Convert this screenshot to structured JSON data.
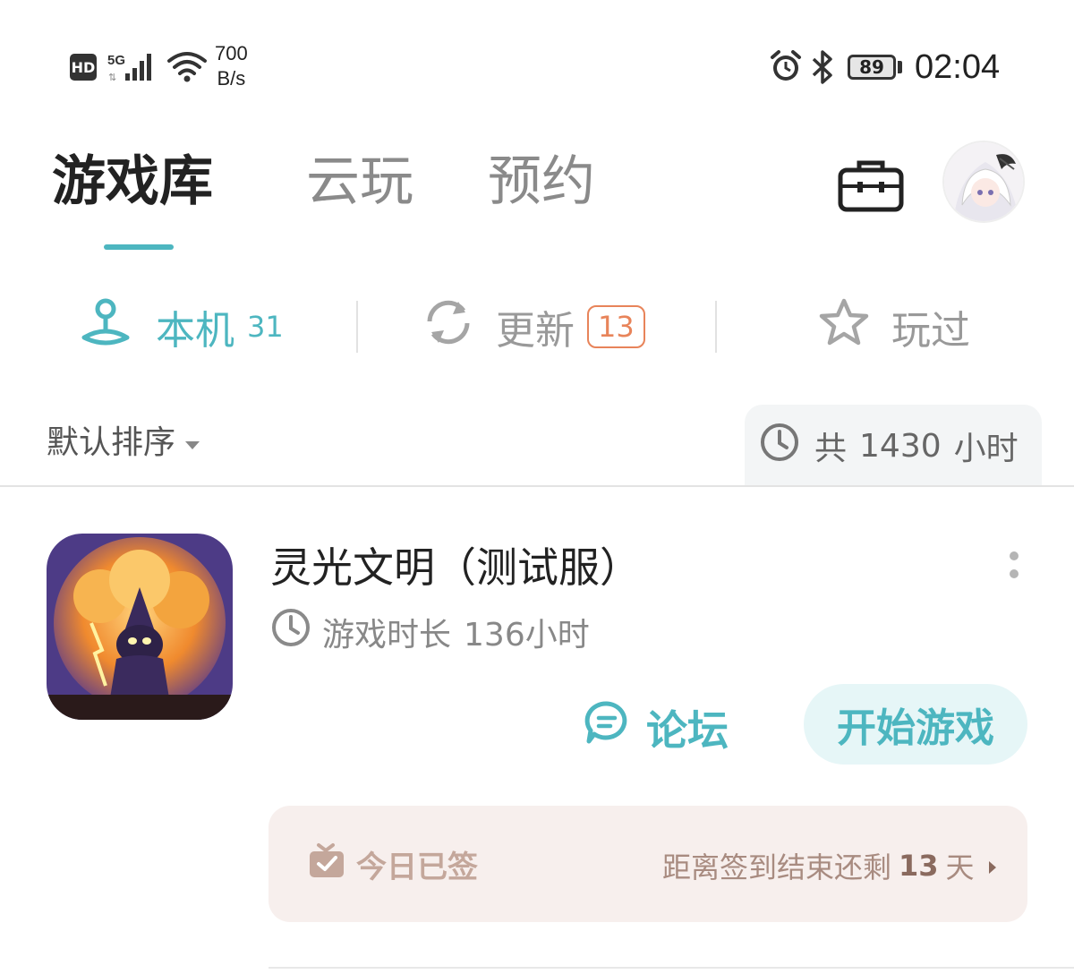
{
  "status_bar": {
    "hd": "HD",
    "network": "5G",
    "speed_value": "700",
    "speed_unit": "B/s",
    "battery": "89",
    "time": "02:04"
  },
  "header": {
    "tabs": [
      {
        "label": "游戏库",
        "active": true
      },
      {
        "label": "云玩",
        "active": false
      },
      {
        "label": "预约",
        "active": false
      }
    ],
    "toolbox_icon": "toolbox-icon",
    "avatar_icon": "avatar"
  },
  "subtabs": [
    {
      "label": "本机",
      "count": "31",
      "icon": "local-device-icon",
      "active": true
    },
    {
      "label": "更新",
      "badge": "13",
      "icon": "refresh-icon",
      "active": false
    },
    {
      "label": "玩过",
      "icon": "star-icon",
      "active": false
    }
  ],
  "sort": {
    "label": "默认排序",
    "total_prefix": "共",
    "total_hours": "1430",
    "total_suffix": "小时"
  },
  "game": {
    "title": "灵光文明（测试服）",
    "playtime_label": "游戏时长",
    "playtime_value": "136小时",
    "forum_label": "论坛",
    "play_label": "开始游戏"
  },
  "checkin": {
    "status": "今日已签",
    "remaining_prefix": "距离签到结束还剩",
    "remaining_days": "13",
    "remaining_suffix": "天"
  },
  "colors": {
    "accent": "#4db6c0",
    "badge": "#e8845a",
    "checkin_bg": "#f7efed"
  }
}
